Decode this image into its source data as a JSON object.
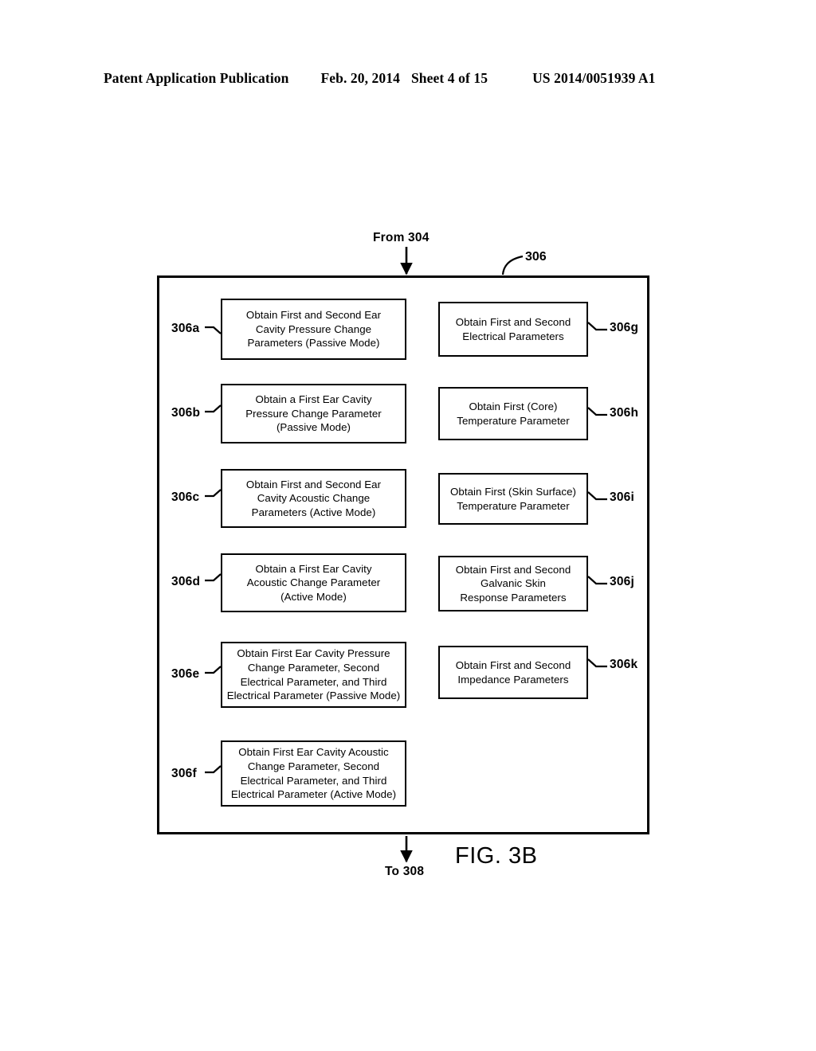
{
  "header": {
    "publication": "Patent Application Publication",
    "date": "Feb. 20, 2014",
    "sheet": "Sheet 4 of 15",
    "number": "US 2014/0051939 A1"
  },
  "figure": {
    "caption": "FIG. 3B",
    "entry_label": "From 304",
    "exit_label": "To 308",
    "container_ref": "306",
    "left_column": [
      {
        "ref": "306a",
        "lines": [
          "Obtain First and Second Ear",
          "Cavity Pressure Change",
          "Parameters (Passive Mode)"
        ]
      },
      {
        "ref": "306b",
        "lines": [
          "Obtain a First Ear Cavity",
          "Pressure Change Parameter",
          "(Passive Mode)"
        ]
      },
      {
        "ref": "306c",
        "lines": [
          "Obtain First and Second Ear",
          "Cavity Acoustic Change",
          "Parameters (Active Mode)"
        ]
      },
      {
        "ref": "306d",
        "lines": [
          "Obtain a First Ear Cavity",
          "Acoustic Change Parameter",
          "(Active Mode)"
        ]
      },
      {
        "ref": "306e",
        "lines": [
          "Obtain First Ear Cavity Pressure",
          "Change Parameter, Second",
          "Electrical Parameter, and Third",
          "Electrical Parameter (Passive Mode)"
        ]
      },
      {
        "ref": "306f",
        "lines": [
          "Obtain First Ear Cavity Acoustic",
          "Change Parameter, Second",
          "Electrical Parameter, and Third",
          "Electrical Parameter (Active Mode)"
        ]
      }
    ],
    "right_column": [
      {
        "ref": "306g",
        "lines": [
          "Obtain First and Second",
          "Electrical Parameters"
        ]
      },
      {
        "ref": "306h",
        "lines": [
          "Obtain First (Core)",
          "Temperature Parameter"
        ]
      },
      {
        "ref": "306i",
        "lines": [
          "Obtain First (Skin Surface)",
          "Temperature Parameter"
        ]
      },
      {
        "ref": "306j",
        "lines": [
          "Obtain First and Second",
          "Galvanic Skin",
          "Response Parameters"
        ]
      },
      {
        "ref": "306k",
        "lines": [
          "Obtain First and Second",
          "Impedance Parameters"
        ]
      }
    ]
  },
  "colors": {
    "ink": "#000000",
    "paper": "#ffffff"
  }
}
